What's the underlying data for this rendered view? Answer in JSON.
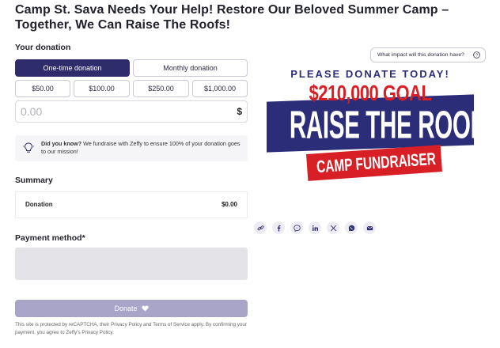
{
  "page": {
    "title": "Camp St. Sava Needs Your Help! Restore Our Beloved Summer Camp – Together, We Can Raise The Roofs!"
  },
  "donation": {
    "heading": "Your donation",
    "frequency": [
      {
        "label": "One-time donation",
        "active": true
      },
      {
        "label": "Monthly donation",
        "active": false
      }
    ],
    "amounts": [
      "$50.00",
      "$100.00",
      "$250.00",
      "$1,000.00"
    ],
    "amount_placeholder": "0.00",
    "currency_symbol": "$",
    "info_bold": "Did you know?",
    "info_text": " We fundraise with Zeffy to ensure 100% of your donation goes to our mission!"
  },
  "summary": {
    "heading": "Summary",
    "label": "Donation",
    "value": "$0.00"
  },
  "payment": {
    "heading": "Payment method*"
  },
  "submit": {
    "label": "Donate"
  },
  "legal": "This site is protected by reCAPTCHA, their Privacy Policy and Terms of Service apply. By confirming your payment, you agree to Zeffy's Privacy Policy.",
  "impact_button": "What impact will this donation have?",
  "banner": {
    "line1": "PLEASE DONATE TODAY!",
    "goal": "$210,000 GOAL",
    "headline": "RAISE THE ROOF",
    "sub": "CAMP FUNDRAISER"
  },
  "colors": {
    "brand_navy": "#2e2c6b",
    "banner_blue": "#2b2d78",
    "banner_red": "#d91f26",
    "disabled_button": "#a9a5c9"
  },
  "share_icons": [
    "link-icon",
    "facebook-icon",
    "messenger-icon",
    "linkedin-icon",
    "x-icon",
    "whatsapp-icon",
    "email-icon"
  ]
}
